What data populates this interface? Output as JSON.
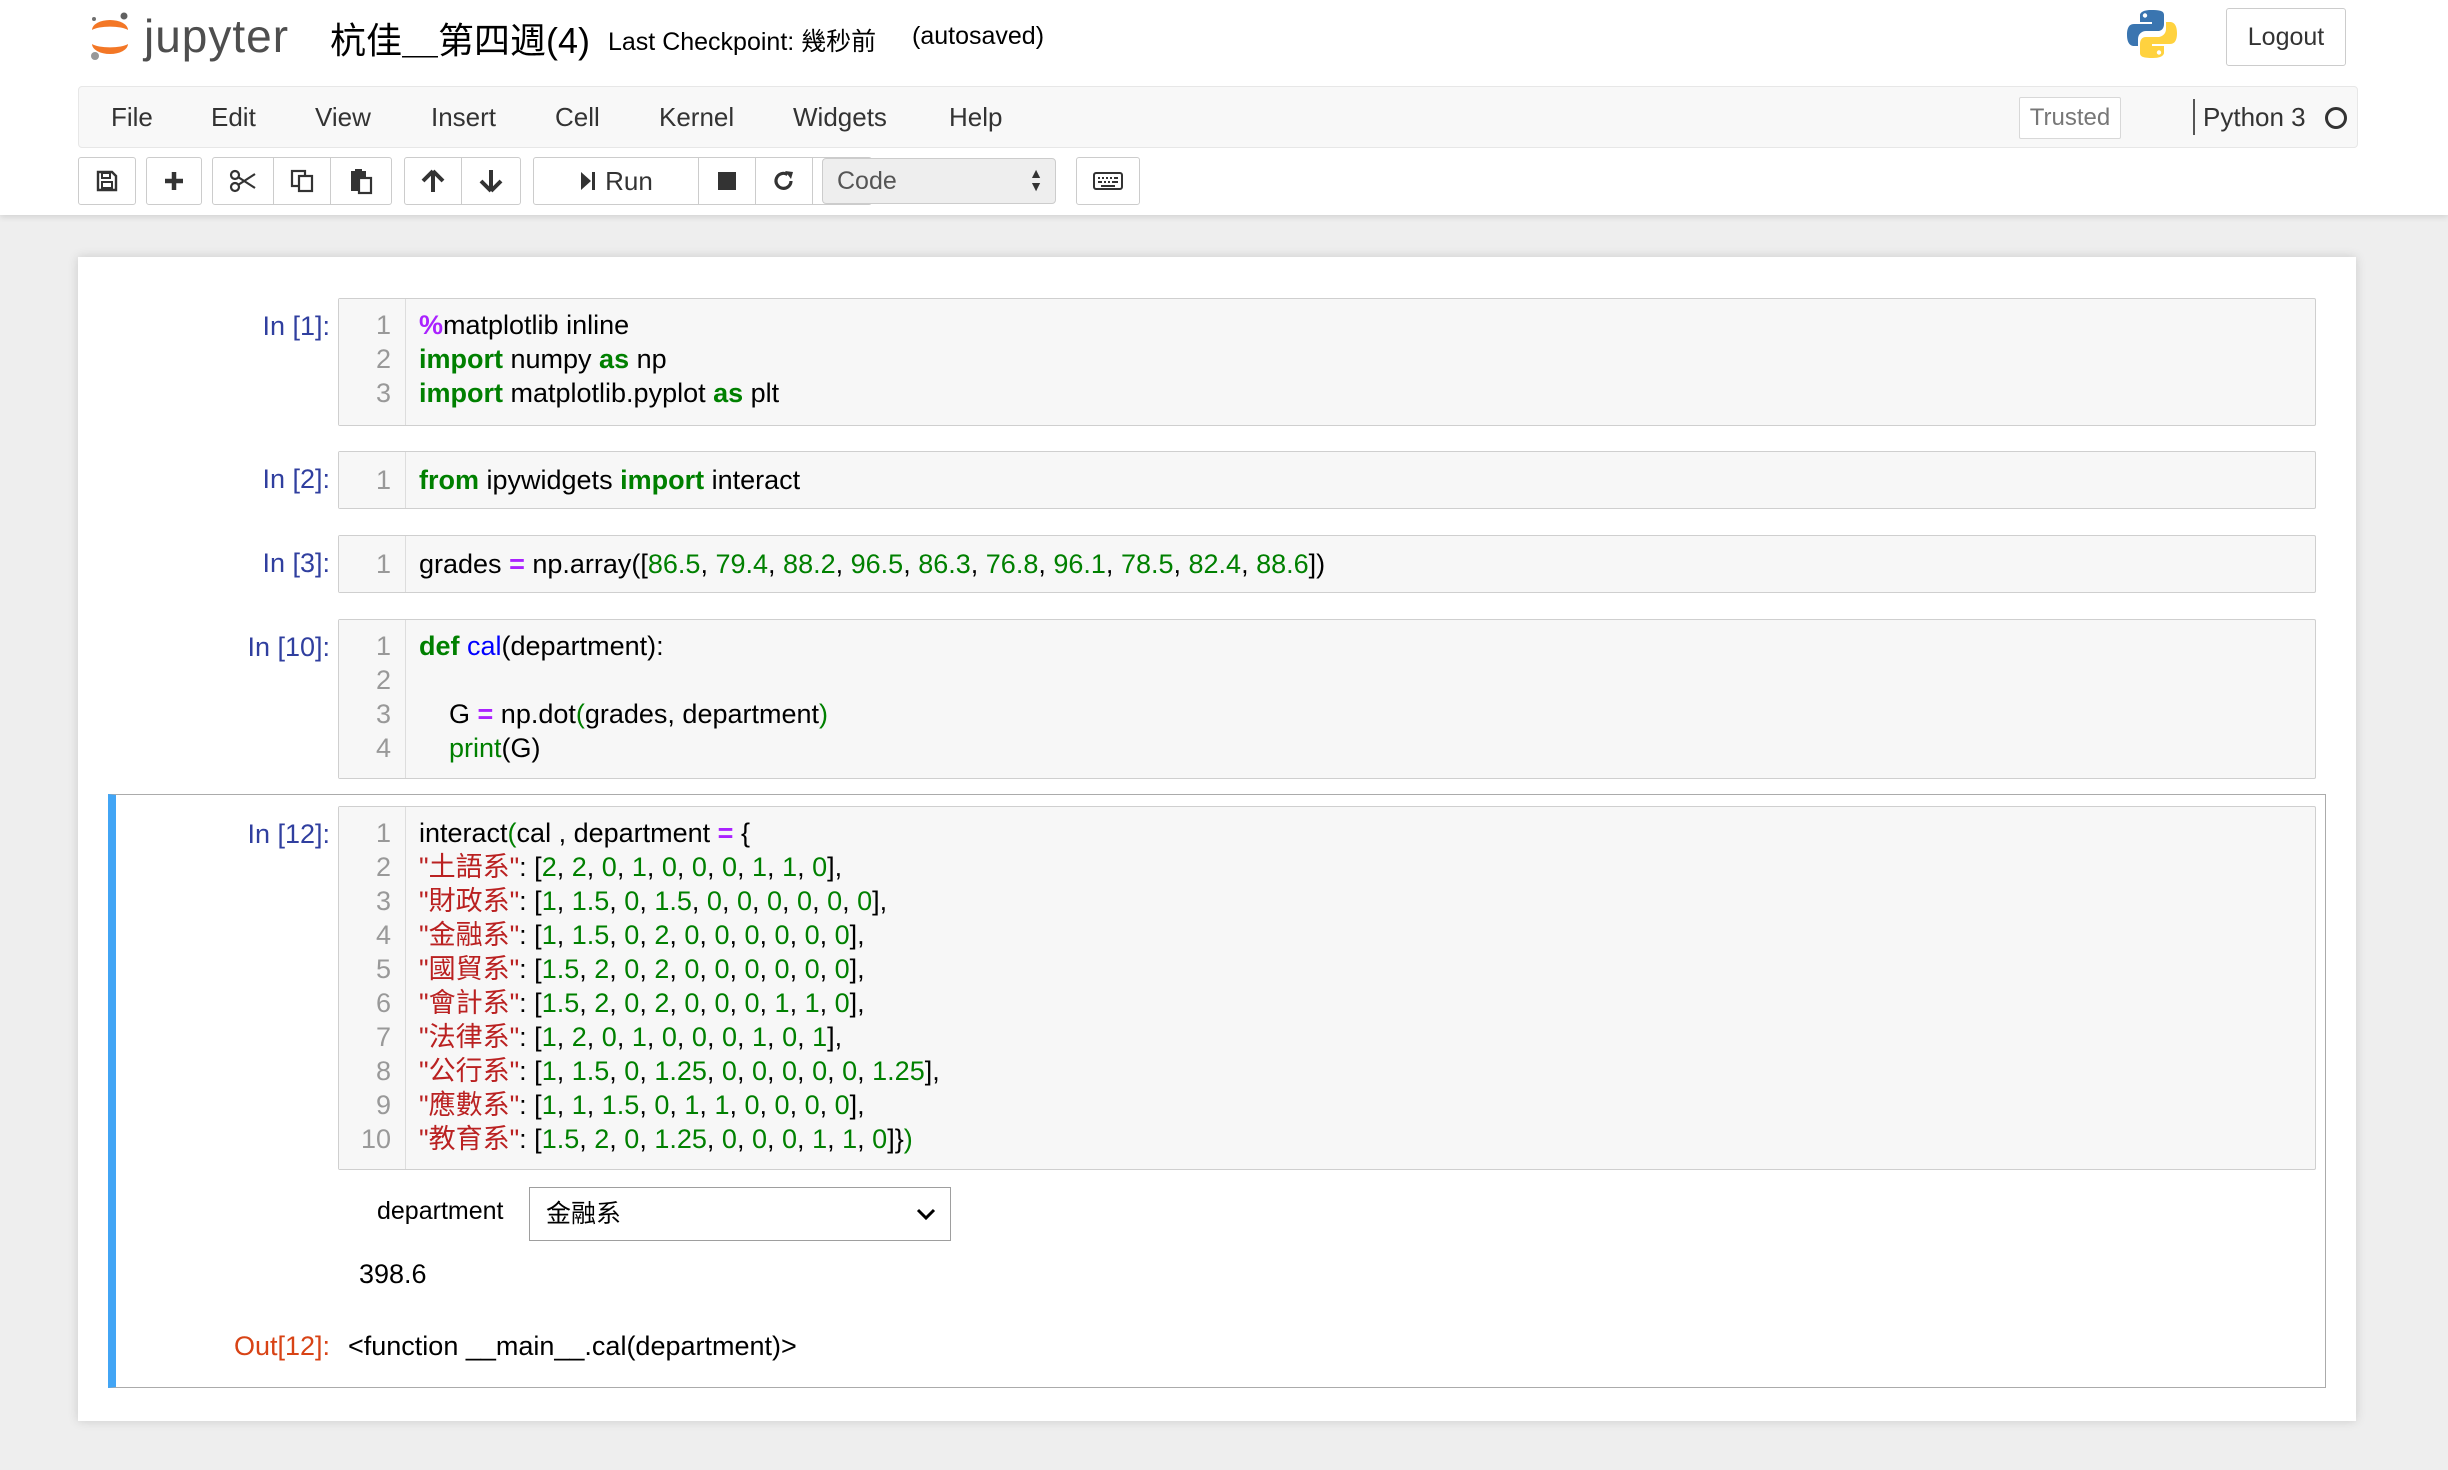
{
  "header": {
    "logo_text": "jupyter",
    "notebook_title": "杭佳＿第四週(4)",
    "checkpoint": "Last Checkpoint: 幾秒前",
    "autosave": "(autosaved)",
    "logout_label": "Logout"
  },
  "menubar": {
    "items": [
      "File",
      "Edit",
      "View",
      "Insert",
      "Cell",
      "Kernel",
      "Widgets",
      "Help"
    ],
    "trusted_label": "Trusted",
    "kernel_name": "Python 3"
  },
  "toolbar": {
    "run_label": "Run",
    "cell_type": "Code",
    "icons": [
      "save-icon",
      "plus-icon",
      "cut-icon",
      "copy-icon",
      "paste-icon",
      "arrow-up-icon",
      "arrow-down-icon",
      "run-icon",
      "stop-icon",
      "restart-icon",
      "fast-forward-icon",
      "keyboard-icon"
    ]
  },
  "cells": [
    {
      "prompt": "In [1]:",
      "lines": [
        "%matplotlib inline",
        "import numpy as np",
        "import matplotlib.pyplot as plt"
      ]
    },
    {
      "prompt": "In [2]:",
      "lines": [
        "from ipywidgets import interact"
      ]
    },
    {
      "prompt": "In [3]:",
      "lines": [
        "grades = np.array([86.5, 79.4, 88.2, 96.5, 86.3, 76.8, 96.1, 78.5, 82.4, 88.6])"
      ]
    },
    {
      "prompt": "In [10]:",
      "lines": [
        "def cal(department):",
        "",
        "    G = np.dot(grades, department)",
        "    print(G)"
      ]
    },
    {
      "prompt": "In [12]:",
      "lines": [
        "interact(cal , department = {",
        "\"土語系\": [2, 2, 0, 1, 0, 0, 0, 1, 1, 0],",
        "\"財政系\": [1, 1.5, 0, 1.5, 0, 0, 0, 0, 0, 0],",
        "\"金融系\": [1, 1.5, 0, 2, 0, 0, 0, 0, 0, 0],",
        "\"國貿系\": [1.5, 2, 0, 2, 0, 0, 0, 0, 0, 0],",
        "\"會計系\": [1.5, 2, 0, 2, 0, 0, 0, 1, 1, 0],",
        "\"法律系\": [1, 2, 0, 1, 0, 0, 0, 1, 0, 1],",
        "\"公行系\": [1, 1.5, 0, 1.25, 0, 0, 0, 0, 0, 1.25],",
        "\"應數系\": [1, 1, 1.5, 0, 1, 1, 0, 0, 0, 0],",
        "\"教育系\": [1.5, 2, 0, 1.25, 0, 0, 0, 1, 1, 0]})"
      ],
      "widget": {
        "label": "department",
        "selected": "金融系"
      },
      "stdout": "398.6",
      "out_prompt": "Out[12]:",
      "out_text": "<function __main__.cal(department)>"
    }
  ],
  "colors": {
    "prompt_in": "#303f9f",
    "prompt_out": "#d84315",
    "keyword": "#008000",
    "string": "#ba2121",
    "operator": "#aa22ff",
    "function_name": "#0000ff",
    "selected_cell_bar": "#42a5f5",
    "logo_orange": "#f37726"
  }
}
